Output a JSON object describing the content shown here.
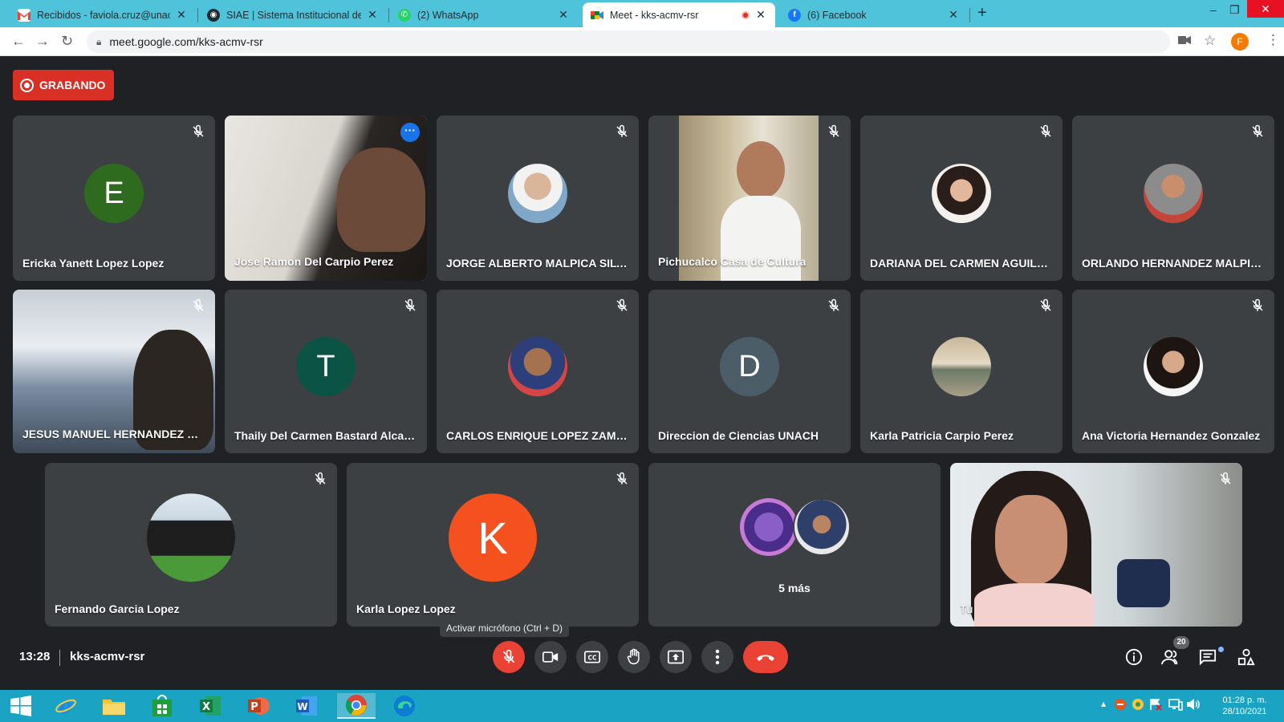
{
  "browser": {
    "tabs": [
      {
        "title": "Recibidos - faviola.cruz@unach.m",
        "favicon": "gmail-icon"
      },
      {
        "title": "SIAE | Sistema Institucional de Ac",
        "favicon": "siae-icon"
      },
      {
        "title": "(2) WhatsApp",
        "favicon": "whatsapp-icon"
      },
      {
        "title": "Meet - kks-acmv-rsr",
        "favicon": "meet-icon",
        "active": true,
        "recording": true
      },
      {
        "title": "(6) Facebook",
        "favicon": "facebook-icon"
      }
    ],
    "url": "meet.google.com/kks-acmv-rsr",
    "profile_initial": "F"
  },
  "meet": {
    "recording_label": "GRABANDO",
    "participants": [
      {
        "name": "Ericka Yanett Lopez Lopez",
        "avatar": "letter",
        "letter": "E",
        "color": "#2f6b1f"
      },
      {
        "name": "Jose Ramon Del Carpio Perez",
        "avatar": "video",
        "pinned": true
      },
      {
        "name": "JORGE ALBERTO MALPICA SILVA",
        "avatar": "photo"
      },
      {
        "name": "Pichucalco Casa de Cultura",
        "avatar": "video"
      },
      {
        "name": "DARIANA DEL CARMEN AGUILA...",
        "avatar": "photo"
      },
      {
        "name": "ORLANDO HERNANDEZ MALPICA",
        "avatar": "photo"
      },
      {
        "name": "JESUS MANUEL HERNANDEZ M...",
        "avatar": "video"
      },
      {
        "name": "Thaily Del Carmen Bastard Alcaz...",
        "avatar": "letter",
        "letter": "T",
        "color": "#0b5345"
      },
      {
        "name": "CARLOS ENRIQUE LOPEZ ZAMO...",
        "avatar": "photo"
      },
      {
        "name": "Direccion de Ciencias UNACH",
        "avatar": "letter",
        "letter": "D",
        "color": "#4b5d67"
      },
      {
        "name": "Karla Patricia Carpio Perez",
        "avatar": "photo"
      },
      {
        "name": "Ana Victoria Hernandez Gonzalez",
        "avatar": "photo"
      },
      {
        "name": "Fernando Garcia Lopez",
        "avatar": "photo"
      },
      {
        "name": "Karla Lopez Lopez",
        "avatar": "letter",
        "letter": "K",
        "color": "#f4511e"
      }
    ],
    "more_label": "5 más",
    "self_label": "Tú",
    "tooltip": "Activar micrófono (Ctrl + D)",
    "time": "13:28",
    "meeting_code": "kks-acmv-rsr",
    "people_count": "20"
  },
  "taskbar": {
    "time": "01:28 p. m.",
    "date": "28/10/2021"
  }
}
